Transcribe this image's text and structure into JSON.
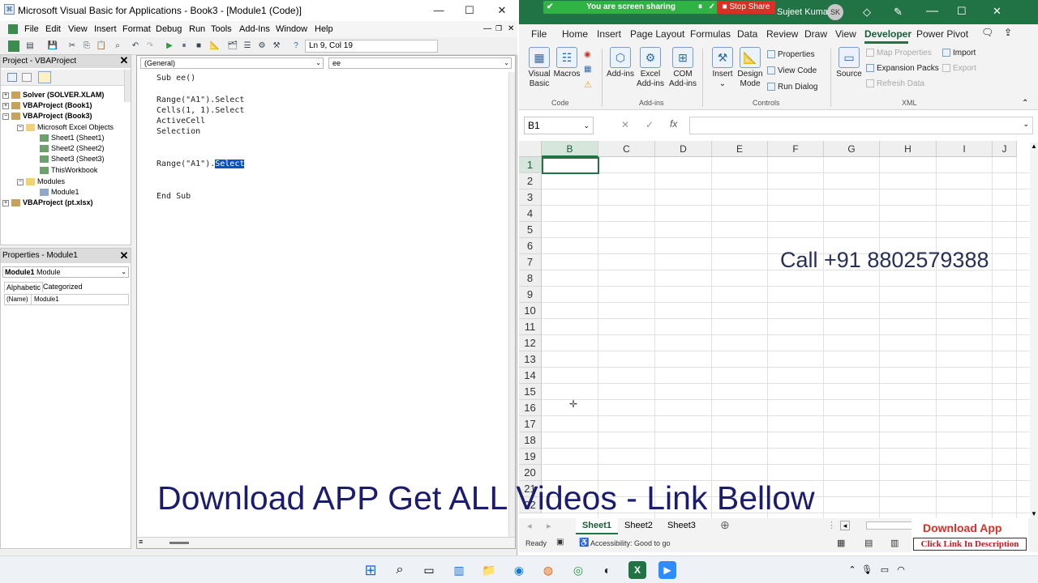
{
  "vba": {
    "window_title": "Microsoft Visual Basic for Applications - Book3 - [Module1 (Code)]",
    "menu": [
      "File",
      "Edit",
      "View",
      "Insert",
      "Format",
      "Debug",
      "Run",
      "Tools",
      "Add-Ins",
      "Window",
      "Help"
    ],
    "status_position": "Ln 9, Col 19",
    "project_pane": {
      "title": "Project - VBAProject",
      "tree": [
        "Solver (SOLVER.XLAM)",
        "VBAProject (Book1)",
        "VBAProject (Book3)",
        "Microsoft Excel Objects",
        "Sheet1 (Sheet1)",
        "Sheet2 (Sheet2)",
        "Sheet3 (Sheet3)",
        "ThisWorkbook",
        "Modules",
        "Module1",
        "VBAProject (pt.xlsx)"
      ]
    },
    "properties_pane": {
      "title": "Properties - Module1",
      "object_name": "Module1",
      "object_type": "Module",
      "tabs": [
        "Alphabetic",
        "Categorized"
      ],
      "row_name": "(Name)",
      "row_value": "Module1"
    },
    "code_window": {
      "object_combo": "(General)",
      "proc_combo": "ee",
      "lines": [
        "Sub ee()",
        "",
        "Range(\"A1\").Select",
        "Cells(1, 1).Select",
        "ActiveCell",
        "Selection",
        "",
        "",
        "Range(\"A1\").",
        "",
        "",
        "End Sub"
      ],
      "selected_word": "Select"
    }
  },
  "excel": {
    "sharing_banner": "You are screen sharing",
    "stop_share": "Stop Share",
    "user_name": "Sujeet Kumar",
    "user_initials": "SK",
    "ribbon_tabs": [
      "File",
      "Home",
      "Insert",
      "Page Layout",
      "Formulas",
      "Data",
      "Review",
      "Draw",
      "View",
      "Developer",
      "Power Pivot"
    ],
    "active_tab": "Developer",
    "groups": {
      "code": {
        "label": "Code",
        "visual_basic": "Visual Basic",
        "macros": "Macros"
      },
      "addins": {
        "label": "Add-ins",
        "add_ins": "Add-ins",
        "excel_add_ins": "Excel Add-ins",
        "com_add_ins": "COM Add-ins"
      },
      "controls": {
        "label": "Controls",
        "insert": "Insert",
        "design_mode": "Design Mode",
        "properties": "Properties",
        "view_code": "View Code",
        "run_dialog": "Run Dialog"
      },
      "xml": {
        "label": "XML",
        "source": "Source",
        "map_properties": "Map Properties",
        "expansion_packs": "Expansion Packs",
        "refresh_data": "Refresh Data",
        "import": "Import",
        "export": "Export"
      }
    },
    "name_box": "B1",
    "fx": "fx",
    "columns": [
      "B",
      "C",
      "D",
      "E",
      "F",
      "G",
      "H",
      "I",
      "J"
    ],
    "rows": [
      "1",
      "2",
      "3",
      "4",
      "5",
      "6",
      "7",
      "8",
      "9",
      "10",
      "11",
      "12",
      "13",
      "14",
      "15",
      "16",
      "17",
      "18",
      "19",
      "20",
      "21",
      "22"
    ],
    "overlay_call": "Call +91 8802579388",
    "sheet_tabs": [
      "Sheet1",
      "Sheet2",
      "Sheet3"
    ],
    "active_sheet": "Sheet1",
    "status_ready": "Ready",
    "accessibility": "Accessibility: Good to go"
  },
  "overlay": {
    "banner": "Download APP Get ALL Videos -  Link Bellow",
    "download_app": "Download App",
    "click_link": "Click Link In Description"
  },
  "colors": {
    "excel_green": "#217346",
    "sharing_green": "#2fb344",
    "stop_red": "#d93025",
    "banner_navy": "#1c1c6e",
    "overlay_text": "#2a2f55",
    "selection_blue": "#0a50c8"
  }
}
